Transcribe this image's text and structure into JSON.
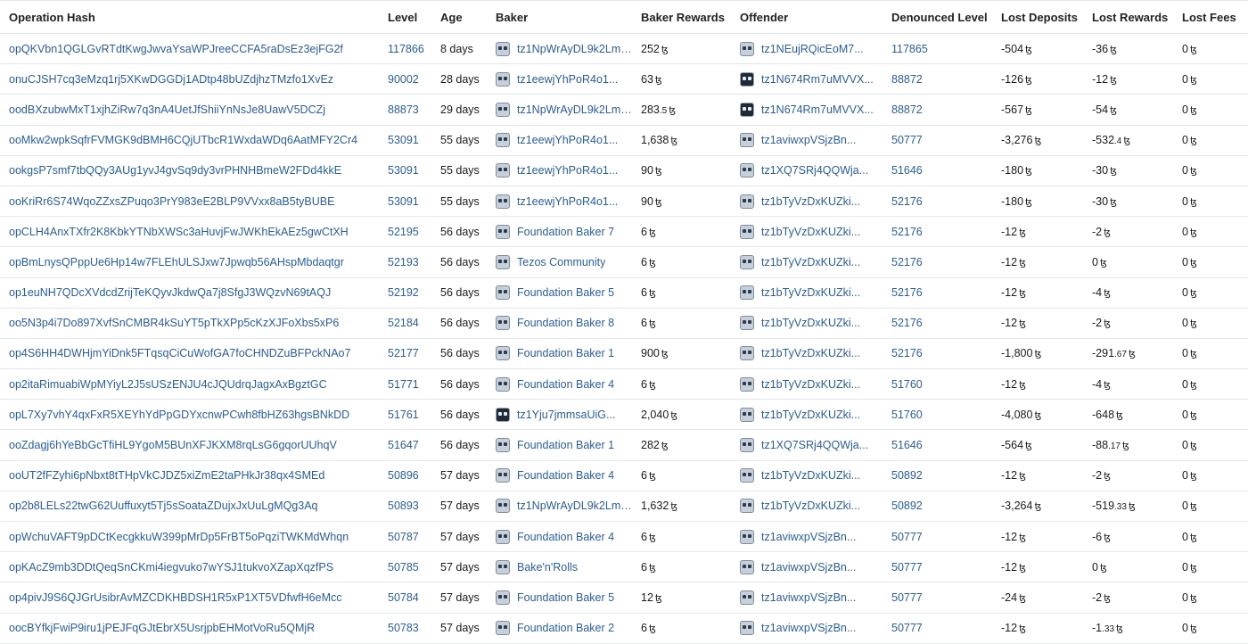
{
  "columns": {
    "hash": "Operation Hash",
    "level": "Level",
    "age": "Age",
    "baker": "Baker",
    "rewards": "Baker Rewards",
    "offender": "Offender",
    "denounced": "Denounced Level",
    "lost_deposits": "Lost Deposits",
    "lost_rewards": "Lost Rewards",
    "lost_fees": "Lost Fees"
  },
  "currency_symbol": "ꜩ",
  "rows": [
    {
      "hash": "opQKVbn1QGLGvRTdtKwgJwvaYsaWPJreeCCFA5raDsEz3ejFG2f",
      "level": "117866",
      "age": "8 days",
      "baker": "tz1NpWrAyDL9k2Lmc...",
      "baker_avatar": "light",
      "rewards": "252",
      "rewards_dec": "",
      "offender": "tz1NEujRQicEoM7...",
      "offender_avatar": "light",
      "denounced": "117865",
      "lost_deposits": "-504",
      "lost_rewards": "-36",
      "lost_rewards_dec": "",
      "lost_fees": "0"
    },
    {
      "hash": "onuCJSH7cq3eMzq1rj5XKwDGGDj1ADtp48bUZdjhzTMzfo1XvEz",
      "level": "90002",
      "age": "28 days",
      "baker": "tz1eewjYhPoR4o1...",
      "baker_avatar": "light",
      "rewards": "63",
      "rewards_dec": "",
      "offender": "tz1N674Rm7uMVVX...",
      "offender_avatar": "dark",
      "denounced": "88872",
      "lost_deposits": "-126",
      "lost_rewards": "-12",
      "lost_rewards_dec": "",
      "lost_fees": "0"
    },
    {
      "hash": "oodBXzubwMxT1xjhZiRw7q3nA4UetJfShiiYnNsJe8UawV5DCZj",
      "level": "88873",
      "age": "29 days",
      "baker": "tz1NpWrAyDL9k2Lmc...",
      "baker_avatar": "light",
      "rewards": "283",
      "rewards_dec": ".5",
      "offender": "tz1N674Rm7uMVVX...",
      "offender_avatar": "dark",
      "denounced": "88872",
      "lost_deposits": "-567",
      "lost_rewards": "-54",
      "lost_rewards_dec": "",
      "lost_fees": "0"
    },
    {
      "hash": "ooMkw2wpkSqfrFVMGK9dBMH6CQjUTbcR1WxdaWDq6AatMFY2Cr4",
      "level": "53091",
      "age": "55 days",
      "baker": "tz1eewjYhPoR4o1...",
      "baker_avatar": "light",
      "rewards": "1,638",
      "rewards_dec": "",
      "offender": "tz1aviwxpVSjzBn...",
      "offender_avatar": "light",
      "denounced": "50777",
      "lost_deposits": "-3,276",
      "lost_rewards": "-532",
      "lost_rewards_dec": ".4",
      "lost_fees": "0"
    },
    {
      "hash": "ookgsP7smf7tbQQy3AUg1yvJ4gvSq9dy3vrPHNHBmeW2FDd4kkE",
      "level": "53091",
      "age": "55 days",
      "baker": "tz1eewjYhPoR4o1...",
      "baker_avatar": "light",
      "rewards": "90",
      "rewards_dec": "",
      "offender": "tz1XQ7SRj4QQWja...",
      "offender_avatar": "light",
      "denounced": "51646",
      "lost_deposits": "-180",
      "lost_rewards": "-30",
      "lost_rewards_dec": "",
      "lost_fees": "0"
    },
    {
      "hash": "ooKriRr6S74WqoZZxsZPuqo3PrY983eE2BLP9VVxx8aB5tyBUBE",
      "level": "53091",
      "age": "55 days",
      "baker": "tz1eewjYhPoR4o1...",
      "baker_avatar": "light",
      "rewards": "90",
      "rewards_dec": "",
      "offender": "tz1bTyVzDxKUZki...",
      "offender_avatar": "light",
      "denounced": "52176",
      "lost_deposits": "-180",
      "lost_rewards": "-30",
      "lost_rewards_dec": "",
      "lost_fees": "0"
    },
    {
      "hash": "opCLH4AnxTXfr2K8KbkYTNbXWSc3aHuvjFwJWKhEkAEz5gwCtXH",
      "level": "52195",
      "age": "56 days",
      "baker": "Foundation Baker 7",
      "baker_avatar": "light",
      "rewards": "6",
      "rewards_dec": "",
      "offender": "tz1bTyVzDxKUZki...",
      "offender_avatar": "light",
      "denounced": "52176",
      "lost_deposits": "-12",
      "lost_rewards": "-2",
      "lost_rewards_dec": "",
      "lost_fees": "0"
    },
    {
      "hash": "opBmLnysQPppUe6Hp14w7FLEhULSJxw7Jpwqb56AHspMbdaqtgr",
      "level": "52193",
      "age": "56 days",
      "baker": "Tezos Community",
      "baker_avatar": "light",
      "rewards": "6",
      "rewards_dec": "",
      "offender": "tz1bTyVzDxKUZki...",
      "offender_avatar": "light",
      "denounced": "52176",
      "lost_deposits": "-12",
      "lost_rewards": "0",
      "lost_rewards_dec": "",
      "lost_fees": "0"
    },
    {
      "hash": "op1euNH7QDcXVdcdZrijTeKQyvJkdwQa7j8SfgJ3WQzvN69tAQJ",
      "level": "52192",
      "age": "56 days",
      "baker": "Foundation Baker 5",
      "baker_avatar": "light",
      "rewards": "6",
      "rewards_dec": "",
      "offender": "tz1bTyVzDxKUZki...",
      "offender_avatar": "light",
      "denounced": "52176",
      "lost_deposits": "-12",
      "lost_rewards": "-4",
      "lost_rewards_dec": "",
      "lost_fees": "0"
    },
    {
      "hash": "oo5N3p4i7Do897XvfSnCMBR4kSuYT5pTkXPp5cKzXJFoXbs5xP6",
      "level": "52184",
      "age": "56 days",
      "baker": "Foundation Baker 8",
      "baker_avatar": "light",
      "rewards": "6",
      "rewards_dec": "",
      "offender": "tz1bTyVzDxKUZki...",
      "offender_avatar": "light",
      "denounced": "52176",
      "lost_deposits": "-12",
      "lost_rewards": "-2",
      "lost_rewards_dec": "",
      "lost_fees": "0"
    },
    {
      "hash": "op4S6HH4DWHjmYiDnk5FTqsqCiCuWofGA7foCHNDZuBFPckNAo7",
      "level": "52177",
      "age": "56 days",
      "baker": "Foundation Baker 1",
      "baker_avatar": "light",
      "rewards": "900",
      "rewards_dec": "",
      "offender": "tz1bTyVzDxKUZki...",
      "offender_avatar": "light",
      "denounced": "52176",
      "lost_deposits": "-1,800",
      "lost_rewards": "-291",
      "lost_rewards_dec": ".67",
      "lost_fees": "0"
    },
    {
      "hash": "op2itaRimuabiWpMYiyL2J5sUSzENJU4cJQUdrqJagxAxBgztGC",
      "level": "51771",
      "age": "56 days",
      "baker": "Foundation Baker 4",
      "baker_avatar": "light",
      "rewards": "6",
      "rewards_dec": "",
      "offender": "tz1bTyVzDxKUZki...",
      "offender_avatar": "light",
      "denounced": "51760",
      "lost_deposits": "-12",
      "lost_rewards": "-4",
      "lost_rewards_dec": "",
      "lost_fees": "0"
    },
    {
      "hash": "opL7Xy7vhY4qxFxR5XEYhYdPpGDYxcnwPCwh8fbHZ63hgsBNkDD",
      "level": "51761",
      "age": "56 days",
      "baker": "tz1Yju7jmmsaUiG...",
      "baker_avatar": "dark",
      "rewards": "2,040",
      "rewards_dec": "",
      "offender": "tz1bTyVzDxKUZki...",
      "offender_avatar": "light",
      "denounced": "51760",
      "lost_deposits": "-4,080",
      "lost_rewards": "-648",
      "lost_rewards_dec": "",
      "lost_fees": "0"
    },
    {
      "hash": "ooZdagj6hYeBbGcTfiHL9YgoM5BUnXFJKXM8rqLsG6gqorUUhqV",
      "level": "51647",
      "age": "56 days",
      "baker": "Foundation Baker 1",
      "baker_avatar": "light",
      "rewards": "282",
      "rewards_dec": "",
      "offender": "tz1XQ7SRj4QQWja...",
      "offender_avatar": "light",
      "denounced": "51646",
      "lost_deposits": "-564",
      "lost_rewards": "-88",
      "lost_rewards_dec": ".17",
      "lost_fees": "0"
    },
    {
      "hash": "ooUT2fFZyhi6pNbxt8tTHpVkCJDZ5xiZmE2taPHkJr38qx4SMEd",
      "level": "50896",
      "age": "57 days",
      "baker": "Foundation Baker 4",
      "baker_avatar": "light",
      "rewards": "6",
      "rewards_dec": "",
      "offender": "tz1bTyVzDxKUZki...",
      "offender_avatar": "light",
      "denounced": "50892",
      "lost_deposits": "-12",
      "lost_rewards": "-2",
      "lost_rewards_dec": "",
      "lost_fees": "0"
    },
    {
      "hash": "op2b8LELs22twG62Uuffuxyt5Tj5sSoataZDujxJxUuLgMQg3Aq",
      "level": "50893",
      "age": "57 days",
      "baker": "tz1NpWrAyDL9k2Lmc...",
      "baker_avatar": "light",
      "rewards": "1,632",
      "rewards_dec": "",
      "offender": "tz1bTyVzDxKUZki...",
      "offender_avatar": "light",
      "denounced": "50892",
      "lost_deposits": "-3,264",
      "lost_rewards": "-519",
      "lost_rewards_dec": ".33",
      "lost_fees": "0"
    },
    {
      "hash": "opWchuVAFT9pDCtKecgkkuW399pMrDp5FrBT5oPqziTWKMdWhqn",
      "level": "50787",
      "age": "57 days",
      "baker": "Foundation Baker 4",
      "baker_avatar": "light",
      "rewards": "6",
      "rewards_dec": "",
      "offender": "tz1aviwxpVSjzBn...",
      "offender_avatar": "light",
      "denounced": "50777",
      "lost_deposits": "-12",
      "lost_rewards": "-6",
      "lost_rewards_dec": "",
      "lost_fees": "0"
    },
    {
      "hash": "opKAcZ9mb3DDtQeqSnCKmi4iegvuko7wYSJ1tukvoXZapXqzfPS",
      "level": "50785",
      "age": "57 days",
      "baker": "Bake'n'Rolls",
      "baker_avatar": "light",
      "rewards": "6",
      "rewards_dec": "",
      "offender": "tz1aviwxpVSjzBn...",
      "offender_avatar": "light",
      "denounced": "50777",
      "lost_deposits": "-12",
      "lost_rewards": "0",
      "lost_rewards_dec": "",
      "lost_fees": "0"
    },
    {
      "hash": "op4pivJ9S6QJGrUsibrAvMZCDKHBDSH1R5xP1XT5VDfwfH6eMcc",
      "level": "50784",
      "age": "57 days",
      "baker": "Foundation Baker 5",
      "baker_avatar": "light",
      "rewards": "12",
      "rewards_dec": "",
      "offender": "tz1aviwxpVSjzBn...",
      "offender_avatar": "light",
      "denounced": "50777",
      "lost_deposits": "-24",
      "lost_rewards": "-2",
      "lost_rewards_dec": "",
      "lost_fees": "0"
    },
    {
      "hash": "oocBYfkjFwiP9iru1jPEJFqGJtEbrX5UsrjpbEHMotVoRu5QMjR",
      "level": "50783",
      "age": "57 days",
      "baker": "Foundation Baker 2",
      "baker_avatar": "light",
      "rewards": "6",
      "rewards_dec": "",
      "offender": "tz1aviwxpVSjzBn...",
      "offender_avatar": "light",
      "denounced": "50777",
      "lost_deposits": "-12",
      "lost_rewards": "-1",
      "lost_rewards_dec": ".33",
      "lost_fees": "0"
    }
  ]
}
